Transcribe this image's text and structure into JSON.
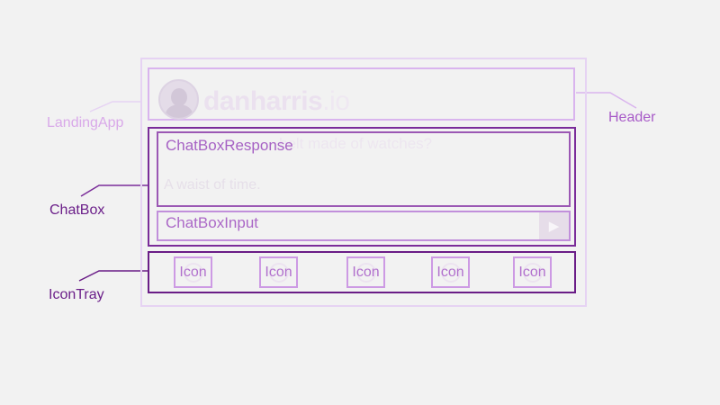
{
  "labels": {
    "landing_app": "LandingApp",
    "header": "Header",
    "chatbox": "ChatBox",
    "icontray": "IconTray"
  },
  "header": {
    "site_name": "danharris",
    "site_tld": ".io"
  },
  "chatbox": {
    "response_label": "ChatBoxResponse",
    "question_text": "belt made of watches?",
    "answer_text": "A waist of time.",
    "input_label": "ChatBoxInput",
    "send_glyph": "▶"
  },
  "icontray": {
    "icons": [
      "Icon",
      "Icon",
      "Icon",
      "Icon",
      "Icon"
    ]
  },
  "colors": {
    "landing_app": "#d9a9e9",
    "header": "#a85bc8",
    "chatbox": "#6b1f89",
    "icontray": "#6b1f89",
    "background": "#f2f2f2"
  }
}
